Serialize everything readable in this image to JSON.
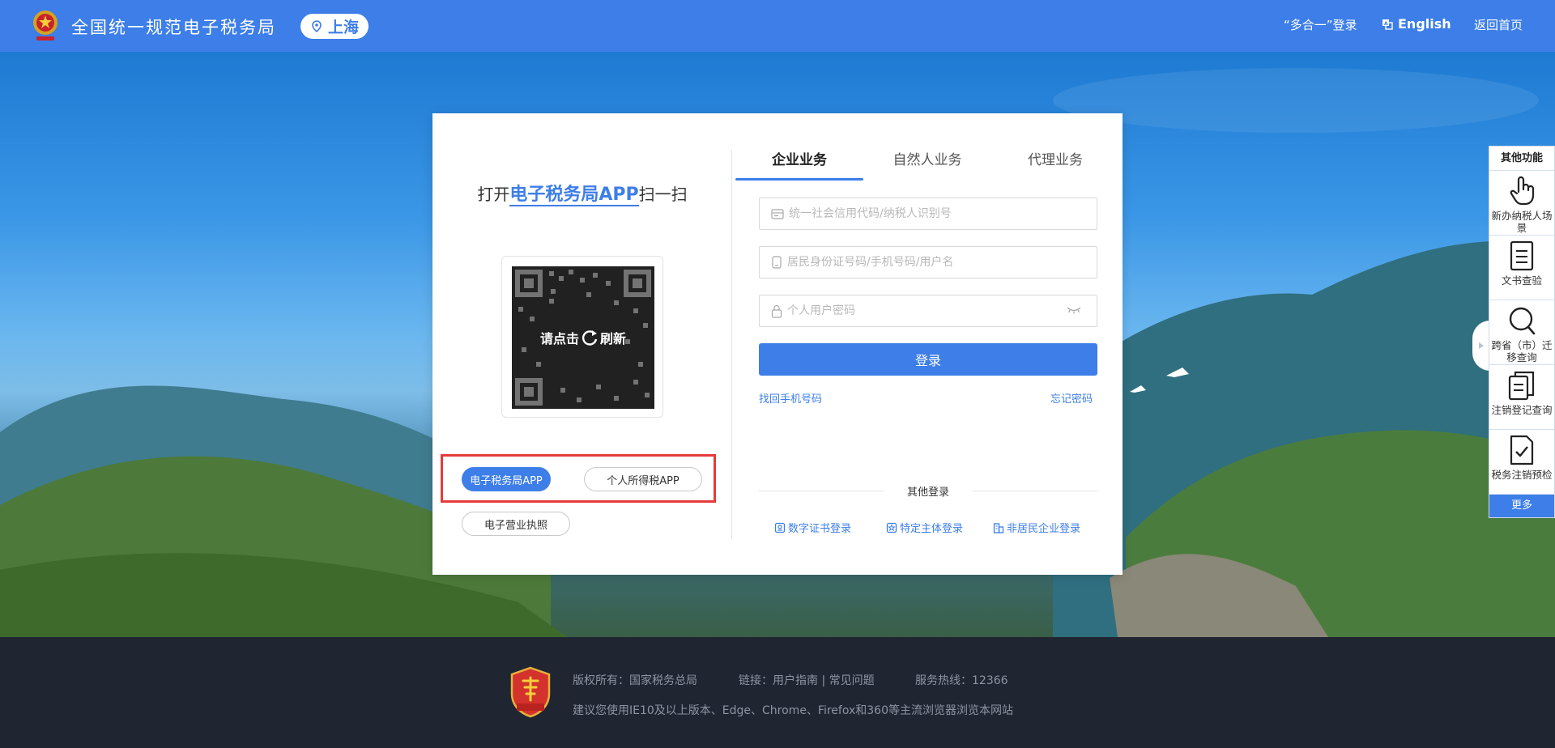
{
  "header": {
    "title": "全国统一规范电子税务局",
    "region": "上海",
    "multi_login": "“多合一”登录",
    "english": "English",
    "home": "返回首页"
  },
  "qr": {
    "title_prefix": "打开",
    "title_highlight": "电子税务局APP",
    "title_suffix": "扫一扫",
    "refresh_left": "请点击",
    "refresh_right": "刷新"
  },
  "app_buttons": {
    "etax_app": "电子税务局APP",
    "iit_app": "个人所得税APP",
    "license": "电子营业执照"
  },
  "tabs": [
    "企业业务",
    "自然人业务",
    "代理业务"
  ],
  "form": {
    "credit_code_placeholder": "统一社会信用代码/纳税人识别号",
    "account_placeholder": "居民身份证号码/手机号码/用户名",
    "password_placeholder": "个人用户密码",
    "login": "登录",
    "recover_phone": "找回手机号码",
    "forgot_password": "忘记密码"
  },
  "other_login": {
    "label": "其他登录",
    "items": [
      "数字证书登录",
      "特定主体登录",
      "非居民企业登录"
    ]
  },
  "side_panel": {
    "title": "其他功能",
    "items": [
      {
        "label": "新办纳税人场景",
        "icon": "pointer-hand-icon"
      },
      {
        "label": "文书查验",
        "icon": "document-icon"
      },
      {
        "label": "跨省（市）迁移查询",
        "icon": "search-icon"
      },
      {
        "label": "注销登记查询",
        "icon": "copy-document-icon"
      },
      {
        "label": "税务注销预检",
        "icon": "check-document-icon"
      }
    ],
    "more": "更多"
  },
  "footer": {
    "copyright": "版权所有：国家税务总局",
    "links_label": "链接：",
    "link_guide": "用户指南",
    "link_sep": "|",
    "link_faq": "常见问题",
    "hotline": "服务热线：12366",
    "browser_note": "建议您使用IE10及以上版本、Edge、Chrome、Firefox和360等主流浏览器浏览本网站"
  },
  "colors": {
    "brand_blue": "#3d7ee8",
    "highlight_red": "#e53b3b",
    "footer_bg": "#1f2531"
  }
}
